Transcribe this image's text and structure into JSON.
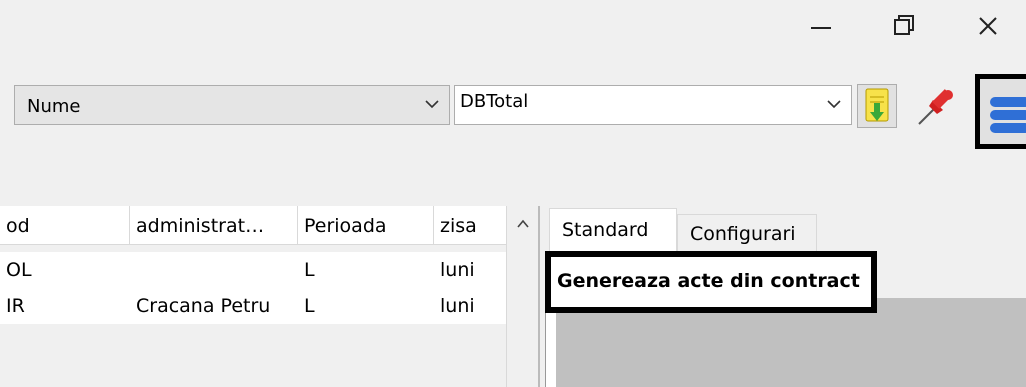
{
  "window": {
    "minimize_icon": "minimize-icon",
    "maximize_icon": "restore-icon",
    "close_icon": "close-icon"
  },
  "toolbar": {
    "field_combo": {
      "value": "Nume"
    },
    "db_combo": {
      "value": "DBTotal"
    },
    "buttons": [
      "download-icon",
      "pin-icon",
      "database-icon"
    ]
  },
  "grid": {
    "columns": [
      "od",
      "administrat…",
      "Perioada",
      "zisa"
    ],
    "rows": [
      [
        "OL",
        "",
        "L",
        "luni"
      ],
      [
        "IR",
        "Cracana Petru",
        "L",
        "luni"
      ]
    ]
  },
  "tabs": [
    "Standard",
    "Configurari"
  ],
  "panel": {
    "action_label": "Genereaza acte din contract"
  },
  "colors": {
    "highlight_border": "#000000",
    "gray_area": "#c0c0c0"
  }
}
